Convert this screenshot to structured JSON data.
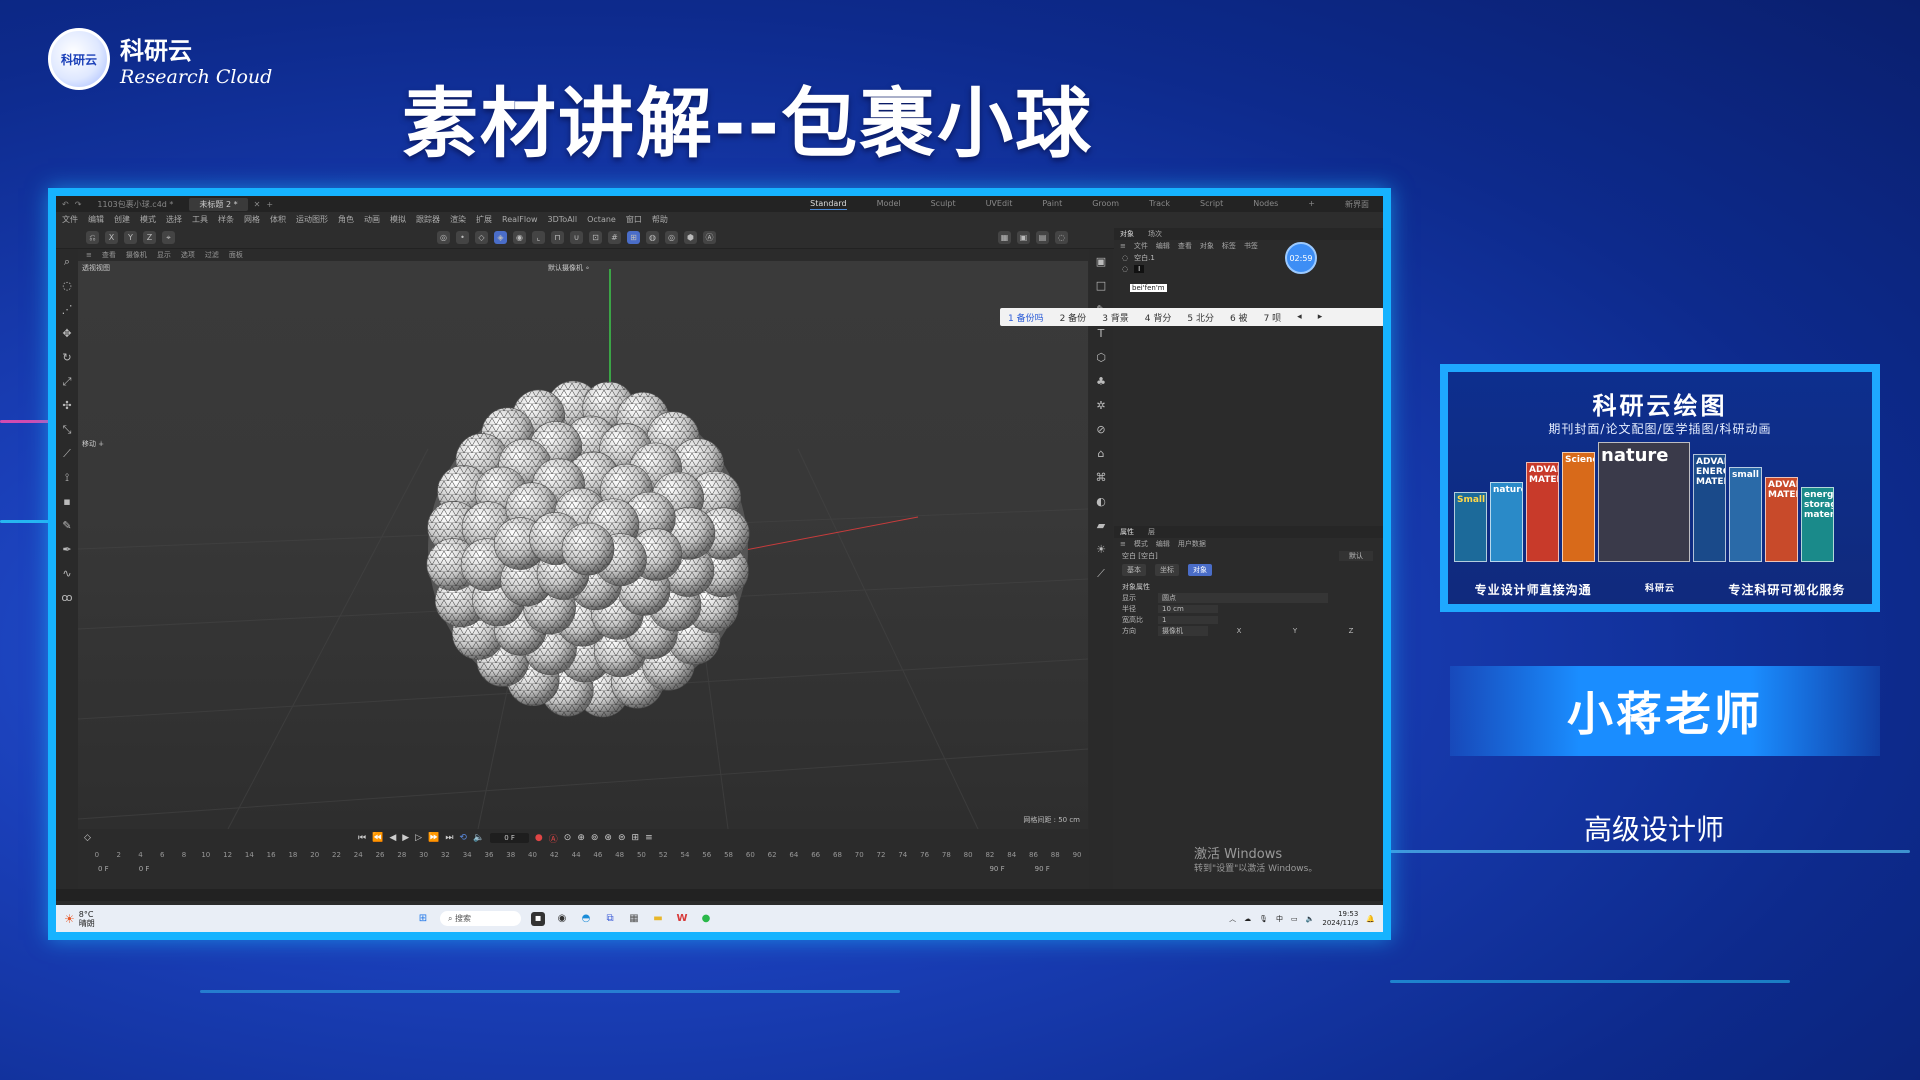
{
  "brand": {
    "logo_text": "科研云",
    "name_cn": "科研云",
    "name_en": "Research Cloud"
  },
  "slide_title": "素材讲解--包裹小球",
  "app": {
    "tabs": [
      "1103包裹小球.c4d *",
      "未标题 2 *"
    ],
    "layouts": [
      "Standard",
      "Model",
      "Sculpt",
      "UVEdit",
      "Paint",
      "Groom",
      "Track",
      "Script",
      "Nodes"
    ],
    "layout_active": "Standard",
    "new_layout": "新界面",
    "menu": [
      "文件",
      "编辑",
      "创建",
      "模式",
      "选择",
      "工具",
      "样条",
      "网格",
      "体积",
      "运动图形",
      "角色",
      "动画",
      "模拟",
      "跟踪器",
      "渲染",
      "扩展",
      "RealFlow",
      "3DToAll",
      "Octane",
      "窗口",
      "帮助"
    ],
    "viewport_menu": [
      "查看",
      "摄像机",
      "显示",
      "选项",
      "过滤",
      "面板"
    ],
    "viewport_label": "透视视图",
    "camera_label": "默认摄像机 ∘",
    "move_label": "移动 ∔",
    "grid_info": "网格间距 : 50 cm",
    "ime": {
      "input": "bei'fen'm",
      "candidates": [
        "1 备份吗",
        "2 备份",
        "3 背景",
        "4 背分",
        "5 北分",
        "6 被",
        "7 呗"
      ]
    },
    "object_panel": {
      "tabs": [
        "对象",
        "场次"
      ],
      "menu": [
        "文件",
        "编辑",
        "查看",
        "对象",
        "标签",
        "书签"
      ],
      "rows": [
        "空白.1",
        "I"
      ],
      "timer": "02:59"
    },
    "attr_panel": {
      "tabs": [
        "属性",
        "层"
      ],
      "menu": [
        "模式",
        "编辑",
        "用户数据"
      ],
      "object": "空白 [空白]",
      "preset": "默认",
      "buttons": [
        "基本",
        "坐标",
        "对象"
      ],
      "active_button": "对象",
      "section": "对象属性",
      "fields": [
        {
          "label": "显示",
          "value": "圆点"
        },
        {
          "label": "半径",
          "value": "10 cm"
        },
        {
          "label": "宽高比",
          "value": "1"
        },
        {
          "label": "方向",
          "value": "摄像机"
        }
      ],
      "axes": [
        "X",
        "Y",
        "Z"
      ]
    },
    "timeline": {
      "current_frame": "0 F",
      "ruler": [
        "0",
        "2",
        "4",
        "6",
        "8",
        "10",
        "12",
        "14",
        "16",
        "18",
        "20",
        "22",
        "24",
        "26",
        "28",
        "30",
        "32",
        "34",
        "36",
        "38",
        "40",
        "42",
        "44",
        "46",
        "48",
        "50",
        "52",
        "54",
        "56",
        "58",
        "60",
        "62",
        "64",
        "66",
        "68",
        "70",
        "72",
        "74",
        "76",
        "78",
        "80",
        "82",
        "84",
        "86",
        "88",
        "90"
      ],
      "start": "0 F",
      "min": "0 F",
      "max": "90 F",
      "end": "90 F"
    },
    "watermark": {
      "line1": "激活 Windows",
      "line2": "转到\"设置\"以激活 Windows。"
    },
    "taskbar": {
      "temp": "8°C",
      "weather": "晴朗",
      "search_placeholder": "搜索",
      "tray_ime": "中",
      "time": "19:53",
      "date": "2024/11/3"
    }
  },
  "ad": {
    "title": "科研云绘图",
    "subtitle": "期刊封面/论文配图/医学插图/科研动画",
    "books": [
      "Small",
      "nature",
      "ADVANCED MATERIALS",
      "Science",
      "nature",
      "ADVANCED ENERGY MATERIALS",
      "small",
      "ADVANCED MATERIALS",
      "energy storage materials"
    ],
    "footer_left": "专业设计师直接沟通",
    "footer_right": "专注科研可视化服务",
    "footer_brand": "科研云"
  },
  "presenter": {
    "name": "小蒋老师",
    "role": "高级设计师"
  }
}
